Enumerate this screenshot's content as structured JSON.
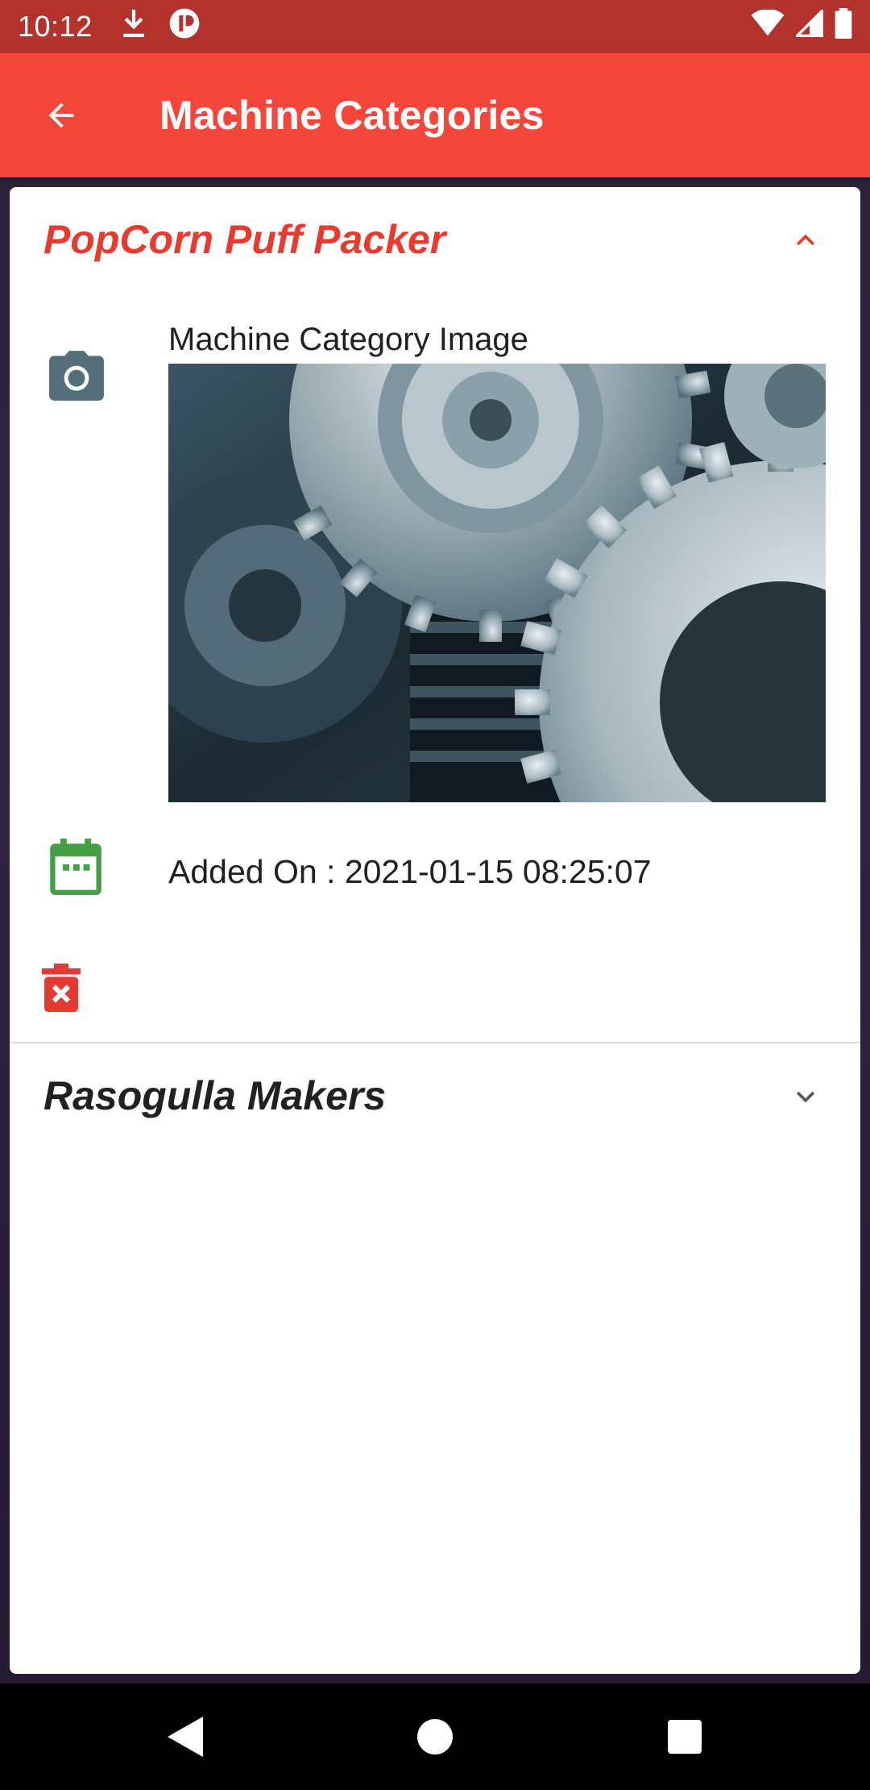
{
  "status_bar": {
    "time": "10:12",
    "icons_left": [
      "download-icon",
      "app-notification-icon"
    ],
    "icons_right": [
      "wifi-icon",
      "signal-icon",
      "battery-icon"
    ]
  },
  "app_bar": {
    "title": "Machine Categories",
    "back_icon": "arrow-back-icon",
    "color": "#f4463b"
  },
  "categories": [
    {
      "name": "PopCorn Puff Packer",
      "expanded": true,
      "image_label": "Machine Category Image",
      "image_alt": "machine gears photo",
      "added_on": "Added On : 2021-01-15 08:25:07",
      "icons": [
        "camera-icon",
        "calendar-icon",
        "delete-icon"
      ]
    },
    {
      "name": "Rasogulla Makers",
      "expanded": false
    }
  ],
  "colors": {
    "accent": "#e83a2f",
    "status_bar": "#b3332c",
    "camera_icon": "#546e7a",
    "calendar_icon": "#43a047",
    "delete_icon": "#e53935"
  },
  "nav_bar": {
    "buttons": [
      "back-triangle-icon",
      "home-circle-icon",
      "recents-square-icon"
    ]
  }
}
